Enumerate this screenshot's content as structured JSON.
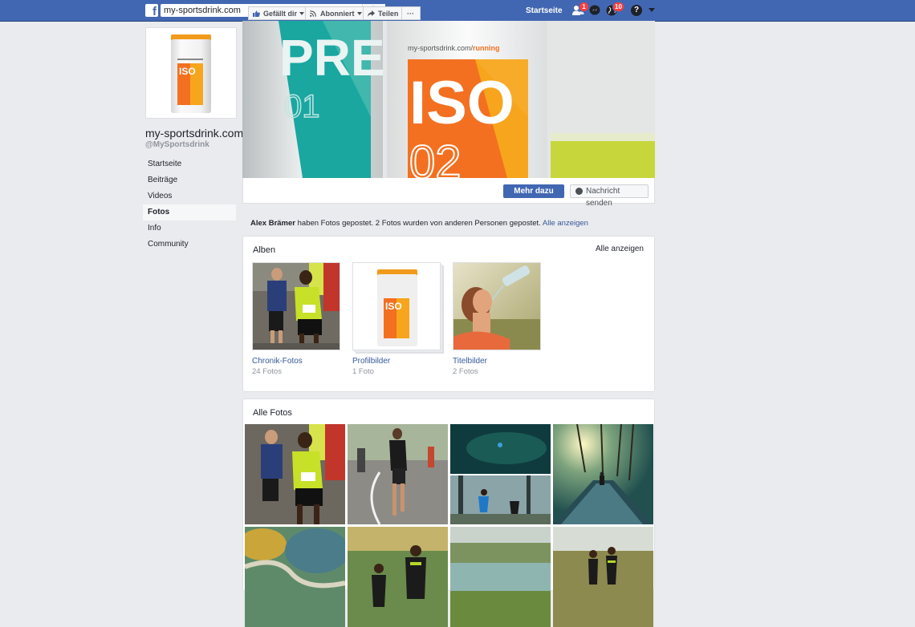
{
  "topbar": {
    "logo_letter": "f",
    "search_value": "my-sportsdrink.com",
    "home_label": "Startseite",
    "friend_requests_badge": "1",
    "notifications_badge": "10",
    "help_glyph": "?",
    "colors": {
      "bar": "#4267b2",
      "badge": "#fa3e3e"
    }
  },
  "page": {
    "name": "my-sportsdrink.com",
    "handle": "@MySportsdrink"
  },
  "leftnav": {
    "items": [
      {
        "label": "Startseite"
      },
      {
        "label": "Beiträge"
      },
      {
        "label": "Videos"
      },
      {
        "label": "Fotos",
        "active": true
      },
      {
        "label": "Info"
      },
      {
        "label": "Community"
      }
    ]
  },
  "cover": {
    "texts": {
      "pre": "PRE",
      "pre_num": "01",
      "url_text": "my-sportsdrink.com/",
      "url_accent": "running",
      "iso": "ISO",
      "iso_num": "02"
    }
  },
  "actions": {
    "like": "Gefällt dir",
    "follow": "Abonniert",
    "share": "Teilen",
    "more": "···",
    "learn_more": "Mehr dazu",
    "message": "Nachricht senden"
  },
  "notice": {
    "author": "Alex Brämer",
    "text": " haben Fotos gepostet. 2 Fotos wurden von anderen Personen gepostet. ",
    "link": "Alle anzeigen"
  },
  "albums": {
    "title": "Alben",
    "see_all": "Alle anzeigen",
    "items": [
      {
        "name": "Chronik-Fotos",
        "count": "24 Fotos"
      },
      {
        "name": "Profilbilder",
        "count": "1 Foto"
      },
      {
        "name": "Titelbilder",
        "count": "2 Fotos"
      }
    ]
  },
  "all_photos": {
    "title": "Alle Fotos"
  }
}
